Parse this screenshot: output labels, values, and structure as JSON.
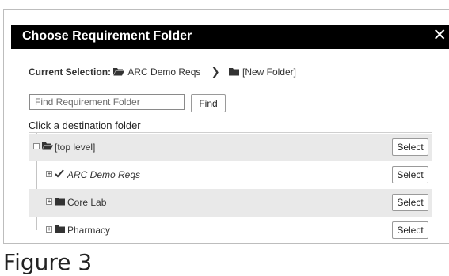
{
  "dialog": {
    "title": "Choose Requirement Folder",
    "close_icon": "close-icon",
    "close_glyph": "✕"
  },
  "current_selection": {
    "label": "Current Selection:",
    "path": [
      "ARC Demo Reqs",
      "[New Folder]"
    ],
    "separator_icon": "chevron-right-icon"
  },
  "search": {
    "placeholder": "Find Requirement Folder",
    "value": "",
    "button_label": "Find"
  },
  "tree": {
    "heading": "Click a destination folder",
    "select_label": "Select",
    "rows": [
      {
        "label": "[top level]",
        "icon": "folder-open-icon",
        "expander": "minus",
        "italic": false,
        "shaded": true
      },
      {
        "label": "ARC Demo Reqs",
        "icon": "checkmark-icon",
        "expander": "plus",
        "italic": true,
        "shaded": false
      },
      {
        "label": "Core Lab",
        "icon": "folder-icon",
        "expander": "plus",
        "italic": false,
        "shaded": true
      },
      {
        "label": "Pharmacy",
        "icon": "folder-icon",
        "expander": "plus",
        "italic": false,
        "shaded": false
      }
    ]
  },
  "caption": "Figure 3"
}
